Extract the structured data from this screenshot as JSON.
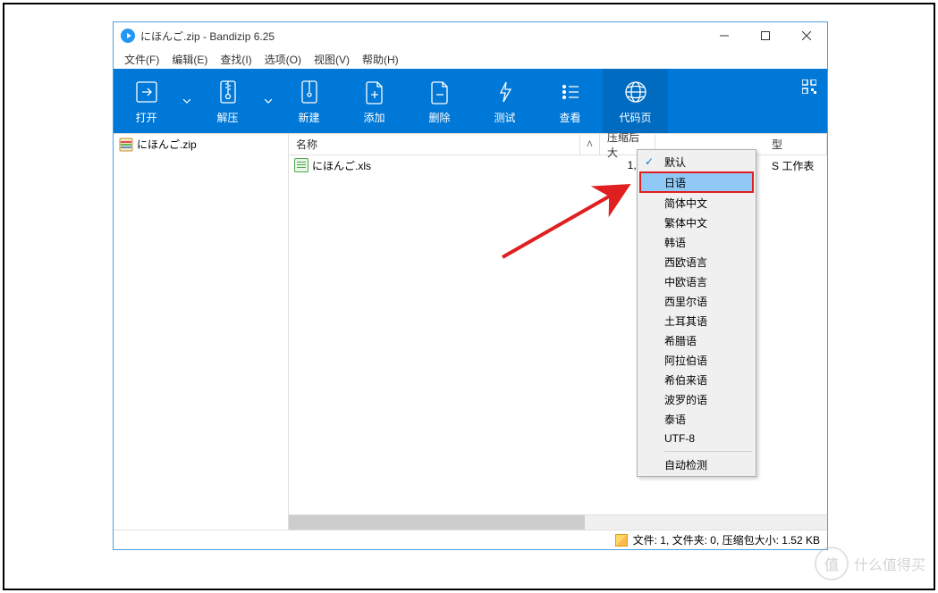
{
  "titlebar": {
    "title": "にほんご.zip - Bandizip 6.25"
  },
  "menubar": {
    "items": [
      "文件(F)",
      "编辑(E)",
      "查找(I)",
      "选项(O)",
      "视图(V)",
      "帮助(H)"
    ]
  },
  "toolbar": {
    "open": "打开",
    "extract": "解压",
    "new": "新建",
    "add": "添加",
    "delete": "删除",
    "test": "测试",
    "view": "查看",
    "codepage": "代码页"
  },
  "sidebar": {
    "root": "にほんご.zip"
  },
  "columns": {
    "name": "名称",
    "compressed_size": "压缩后大",
    "type": "型"
  },
  "files": [
    {
      "name": "にほんご.xls",
      "compressed_size": "1,35",
      "type_suffix": "S 工作表"
    }
  ],
  "dropdown": {
    "items": [
      {
        "label": "默认",
        "checked": true
      },
      {
        "label": "日语",
        "highlighted": true
      },
      {
        "label": "简体中文"
      },
      {
        "label": "繁体中文"
      },
      {
        "label": "韩语"
      },
      {
        "label": "西欧语言"
      },
      {
        "label": "中欧语言"
      },
      {
        "label": "西里尔语"
      },
      {
        "label": "土耳其语"
      },
      {
        "label": "希腊语"
      },
      {
        "label": "阿拉伯语"
      },
      {
        "label": "希伯来语"
      },
      {
        "label": "波罗的语"
      },
      {
        "label": "泰语"
      },
      {
        "label": "UTF-8"
      }
    ],
    "auto_detect": "自动检测"
  },
  "statusbar": {
    "text": "文件: 1, 文件夹: 0, 压缩包大小: 1.52 KB"
  },
  "watermark": {
    "text": "什么值得买",
    "badge": "值"
  }
}
